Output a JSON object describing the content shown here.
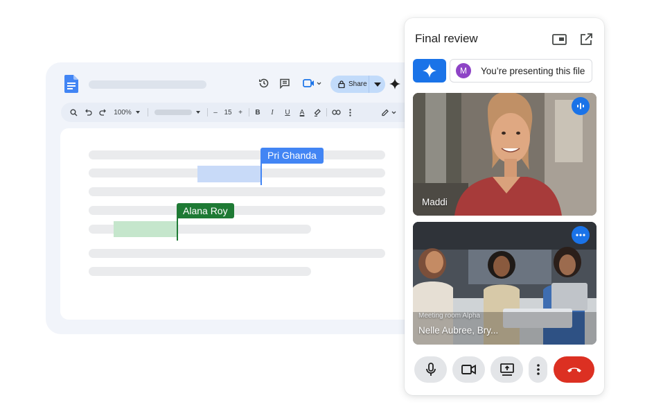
{
  "doc": {
    "collaborators": [
      "Pri Ghanda",
      "Alana Roy"
    ],
    "toolbar": {
      "zoom": "100%",
      "font_size": "15",
      "minus": "–",
      "plus": "+",
      "bold": "B",
      "italic": "I",
      "underline": "U",
      "text_color": "A"
    },
    "share_label": "Share"
  },
  "meet": {
    "title": "Final review",
    "presenting_text": "You’re presenting this file",
    "avatar_letter": "M",
    "tiles": [
      {
        "name": "Maddi"
      },
      {
        "room": "Meeting room Alpha",
        "name": "Nelle Aubree, Bry..."
      }
    ]
  },
  "colors": {
    "accent": "#1a73e8",
    "end_call": "#dc3022",
    "collaborator_blue": "#4285f4",
    "collaborator_green": "#1e7a34",
    "avatar": "#8e44c6"
  },
  "icons": [
    "docs-icon",
    "history-icon",
    "comment-icon",
    "meet-video-icon",
    "lock-icon",
    "sparkle-icon",
    "search-icon",
    "undo-icon",
    "redo-icon",
    "link-icon",
    "more-vert-icon",
    "pen-icon",
    "picture-in-picture-icon",
    "open-in-new-icon",
    "audio-indicator-icon",
    "more-horiz-icon",
    "mic-icon",
    "camera-icon",
    "present-screen-icon",
    "end-call-icon"
  ]
}
